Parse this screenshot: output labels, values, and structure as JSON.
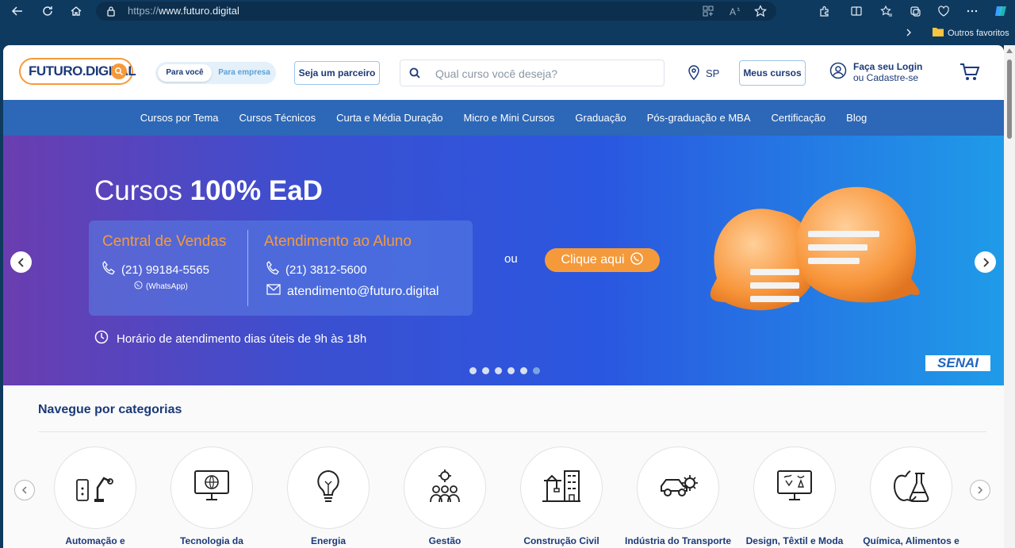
{
  "browser": {
    "url_protocol": "https://",
    "url_host": "www.futuro.digital",
    "favorites_label": "Outros favoritos"
  },
  "header": {
    "logo_text": "FUTURO.DIGITAL",
    "toggle_active": "Para você",
    "toggle_inactive": "Para empresa",
    "partner_label": "Seja um parceiro",
    "search_placeholder": "Qual curso você deseja?",
    "location": "SP",
    "my_courses_label": "Meus cursos",
    "login_line1": "Faça seu Login",
    "login_line2": "ou Cadastre-se"
  },
  "menu": {
    "items": [
      "Cursos por Tema",
      "Cursos Técnicos",
      "Curta e Média Duração",
      "Micro e Mini Cursos",
      "Graduação",
      "Pós-graduação e MBA",
      "Certificação",
      "Blog"
    ]
  },
  "hero": {
    "title_prefix": "Cursos",
    "title_bold": "100% EaD",
    "sales_title": "Central de Vendas",
    "sales_phone": "(21) 99184-5565",
    "sales_whatsapp": "(WhatsApp)",
    "support_title": "Atendimento ao Aluno",
    "support_phone": "(21) 3812-5600",
    "support_email": "atendimento@futuro.digital",
    "or_label": "ou",
    "cta_label": "Clique aqui",
    "hours": "Horário de atendimento dias úteis de  9h às 18h",
    "brand": "SENAI",
    "slide_count": 6,
    "active_slide": 6
  },
  "categories": {
    "title": "Navegue por categorias",
    "items": [
      {
        "label": "Automação e",
        "icon": "robot-arm-icon"
      },
      {
        "label": "Tecnologia da",
        "icon": "monitor-globe-icon"
      },
      {
        "label": "Energia",
        "icon": "lightbulb-icon"
      },
      {
        "label": "Gestão",
        "icon": "team-gear-icon"
      },
      {
        "label": "Construção Civil",
        "icon": "crane-building-icon"
      },
      {
        "label": "Indústria do Transporte",
        "icon": "car-gear-icon"
      },
      {
        "label": "Design, Têxtil e Moda",
        "icon": "monitor-design-icon"
      },
      {
        "label": "Química, Alimentos e",
        "icon": "apple-flask-icon"
      }
    ]
  },
  "colors": {
    "brand_blue": "#1b3a78",
    "menu_blue": "#2d67b7",
    "accent_orange": "#f59a3b"
  }
}
